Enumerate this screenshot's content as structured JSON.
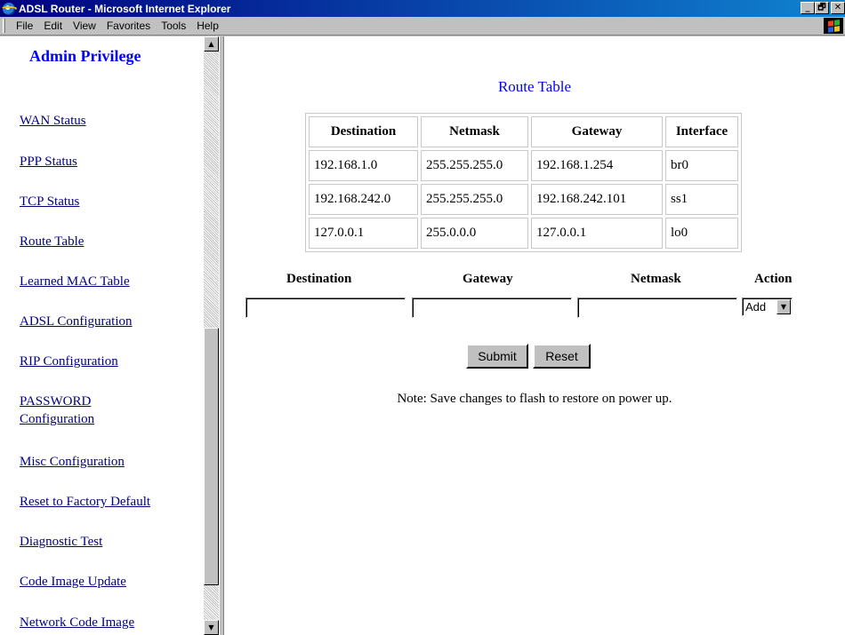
{
  "window": {
    "title": "ADSL Router - Microsoft Internet Explorer",
    "controls": [
      "_",
      "🗗",
      "✕"
    ]
  },
  "menu": [
    {
      "label": "File"
    },
    {
      "label": "Edit"
    },
    {
      "label": "View"
    },
    {
      "label": "Favorites"
    },
    {
      "label": "Tools"
    },
    {
      "label": "Help"
    }
  ],
  "sidebar": {
    "title": "Admin Privilege",
    "items": [
      {
        "label": "WAN Status"
      },
      {
        "label": "PPP Status"
      },
      {
        "label": "TCP Status"
      },
      {
        "label": "Route Table"
      },
      {
        "label": "Learned MAC Table"
      },
      {
        "label": "ADSL Configuration"
      },
      {
        "label": "RIP Configuration"
      },
      {
        "label": "PASSWORD"
      },
      {
        "label": "Configuration"
      },
      {
        "label": "Misc Configuration"
      },
      {
        "label": "Reset to Factory Default"
      },
      {
        "label": "Diagnostic Test"
      },
      {
        "label": "Code Image Update"
      },
      {
        "label": "Network Code Image"
      }
    ]
  },
  "main": {
    "title": "Route Table",
    "table": {
      "headers": [
        "Destination",
        "Netmask",
        "Gateway",
        "Interface"
      ],
      "rows": [
        [
          "192.168.1.0",
          "255.255.255.0",
          "192.168.1.254",
          "br0"
        ],
        [
          "192.168.242.0",
          "255.255.255.0",
          "192.168.242.101",
          "ss1"
        ],
        [
          "127.0.0.1",
          "255.0.0.0",
          "127.0.0.1",
          "lo0"
        ]
      ]
    },
    "form": {
      "labels": {
        "destination": "Destination",
        "gateway": "Gateway",
        "netmask": "Netmask",
        "action": "Action"
      },
      "values": {
        "destination": "",
        "gateway": "",
        "netmask": ""
      },
      "action_selected": "Add",
      "submit_label": "Submit",
      "reset_label": "Reset"
    },
    "note": "Note: Save changes to flash to restore on power up."
  },
  "icons": {
    "app": "ie-globe-icon",
    "windows_flag": "windows-logo-icon",
    "scroll_up": "scroll-up-arrow-icon",
    "scroll_down": "scroll-down-arrow-icon",
    "dropdown": "dropdown-arrow-icon"
  },
  "colors": {
    "titlebar_start": "#000080",
    "titlebar_end": "#1084d0",
    "heading": "#0000ff",
    "link": "#000080",
    "chrome": "#c0c0c0"
  }
}
